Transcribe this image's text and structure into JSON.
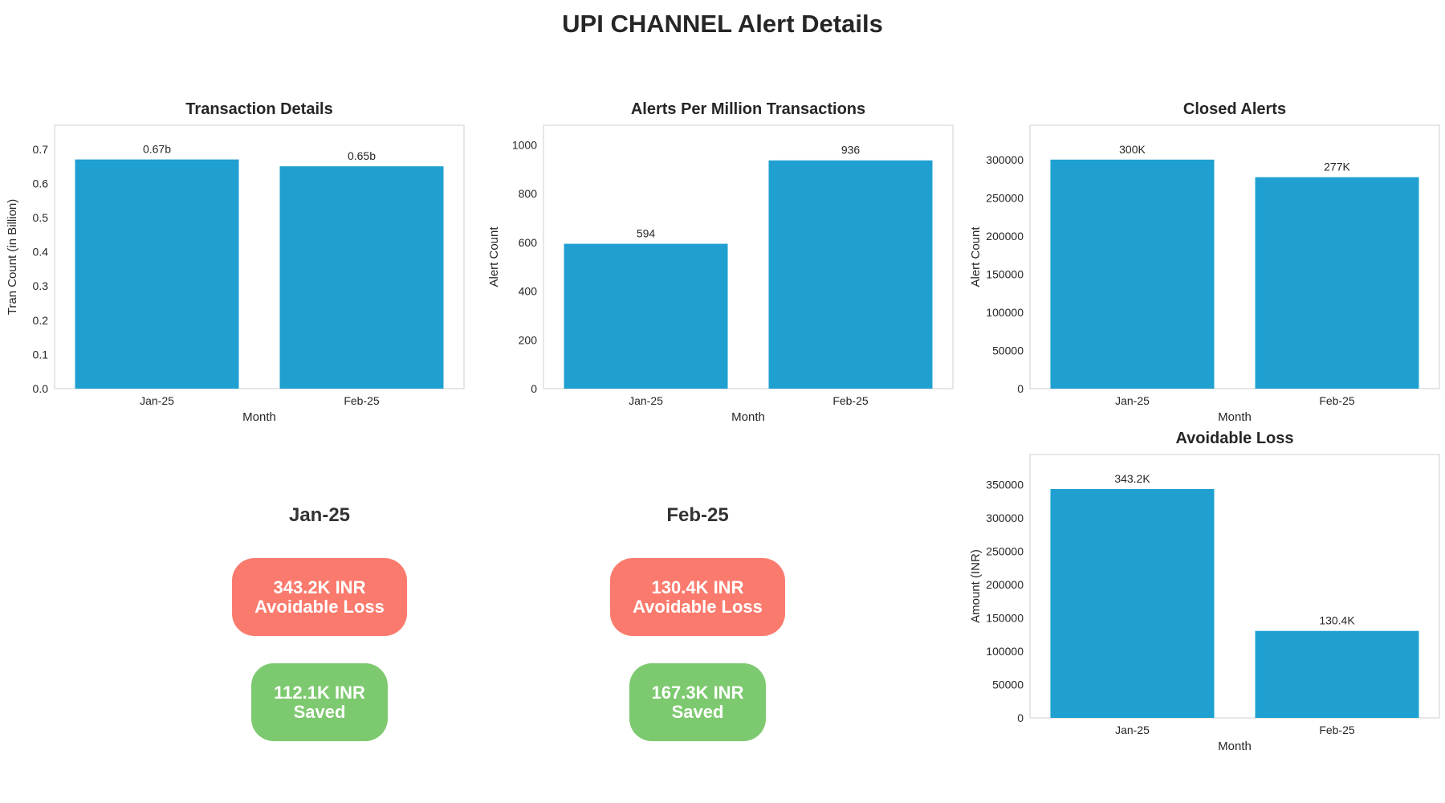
{
  "title": "UPI CHANNEL Alert Details",
  "colors": {
    "bar": "#1fa0d1",
    "loss_card": "#fa7b6e",
    "saved_card": "#7dc96f",
    "axes_border": "#cfcfcf"
  },
  "summary": [
    {
      "month": "Jan-25",
      "loss_value": "343.2K INR",
      "loss_label": "Avoidable Loss",
      "saved_value": "112.1K INR",
      "saved_label": "Saved"
    },
    {
      "month": "Feb-25",
      "loss_value": "130.4K INR",
      "loss_label": "Avoidable Loss",
      "saved_value": "167.3K INR",
      "saved_label": "Saved"
    }
  ],
  "chart_data": [
    {
      "type": "bar",
      "title": "Transaction Details",
      "categories": [
        "Jan-25",
        "Feb-25"
      ],
      "values": [
        0.67,
        0.65
      ],
      "data_labels": [
        "0.67b",
        "0.65b"
      ],
      "xlabel": "Month",
      "ylabel": "Tran Count (in Billion)",
      "ylim": [
        0,
        0.77
      ],
      "yticks": [
        0,
        0.1,
        0.2,
        0.3,
        0.4,
        0.5,
        0.6,
        0.7
      ],
      "ytick_labels": [
        "0.0",
        "0.1",
        "0.2",
        "0.3",
        "0.4",
        "0.5",
        "0.6",
        "0.7"
      ],
      "grid": false
    },
    {
      "type": "bar",
      "title": "Alerts Per Million Transactions",
      "categories": [
        "Jan-25",
        "Feb-25"
      ],
      "values": [
        594,
        936
      ],
      "data_labels": [
        "594",
        "936"
      ],
      "xlabel": "Month",
      "ylabel": "Alert Count",
      "ylim": [
        0,
        1080
      ],
      "yticks": [
        0,
        200,
        400,
        600,
        800,
        1000
      ],
      "ytick_labels": [
        "0",
        "200",
        "400",
        "600",
        "800",
        "1000"
      ],
      "grid": false
    },
    {
      "type": "bar",
      "title": "Closed Alerts",
      "categories": [
        "Jan-25",
        "Feb-25"
      ],
      "values": [
        300000,
        277000
      ],
      "data_labels": [
        "300K",
        "277K"
      ],
      "xlabel": "Month",
      "ylabel": "Alert Count",
      "ylim": [
        0,
        345000
      ],
      "yticks": [
        0,
        50000,
        100000,
        150000,
        200000,
        250000,
        300000
      ],
      "ytick_labels": [
        "0",
        "50000",
        "100000",
        "150000",
        "200000",
        "250000",
        "300000"
      ],
      "grid": false
    },
    {
      "type": "bar",
      "title": "Avoidable Loss",
      "categories": [
        "Jan-25",
        "Feb-25"
      ],
      "values": [
        343200,
        130400
      ],
      "data_labels": [
        "343.2K",
        "130.4K"
      ],
      "xlabel": "Month",
      "ylabel": "Amount (INR)",
      "ylim": [
        0,
        395000
      ],
      "yticks": [
        0,
        50000,
        100000,
        150000,
        200000,
        250000,
        300000,
        350000
      ],
      "ytick_labels": [
        "0",
        "50000",
        "100000",
        "150000",
        "200000",
        "250000",
        "300000",
        "350000"
      ],
      "grid": false
    }
  ]
}
